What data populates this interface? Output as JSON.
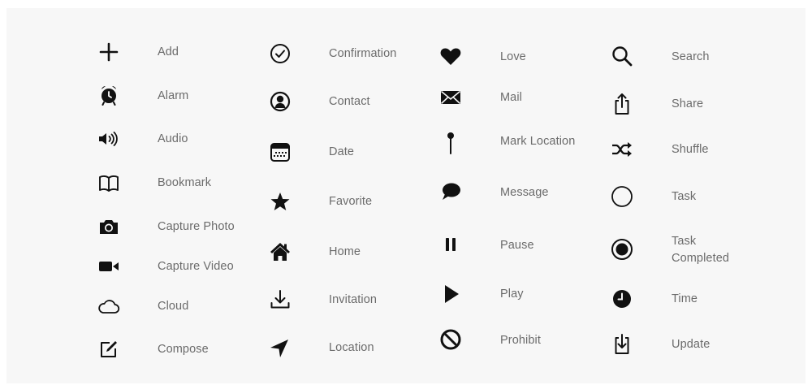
{
  "columns": [
    {
      "items": [
        {
          "icon": "plus-icon",
          "label": "Add"
        },
        {
          "icon": "alarm-icon",
          "label": "Alarm"
        },
        {
          "icon": "speaker-icon",
          "label": "Audio"
        },
        {
          "icon": "open-book-icon",
          "label": "Bookmark"
        },
        {
          "icon": "camera-icon",
          "label": "Capture Photo"
        },
        {
          "icon": "video-camera-icon",
          "label": "Capture Video"
        },
        {
          "icon": "cloud-icon",
          "label": "Cloud"
        },
        {
          "icon": "compose-icon",
          "label": "Compose"
        }
      ]
    },
    {
      "items": [
        {
          "icon": "check-circle-icon",
          "label": "Confirmation"
        },
        {
          "icon": "contact-icon",
          "label": "Contact"
        },
        {
          "icon": "calendar-icon",
          "label": "Date"
        },
        {
          "icon": "star-icon",
          "label": "Favorite"
        },
        {
          "icon": "home-icon",
          "label": "Home"
        },
        {
          "icon": "download-icon",
          "label": "Invitation"
        },
        {
          "icon": "location-arrow-icon",
          "label": "Location"
        }
      ]
    },
    {
      "items": [
        {
          "icon": "heart-icon",
          "label": "Love"
        },
        {
          "icon": "envelope-icon",
          "label": "Mail"
        },
        {
          "icon": "pin-icon",
          "label": "Mark Location"
        },
        {
          "icon": "speech-bubble-icon",
          "label": "Message"
        },
        {
          "icon": "pause-icon",
          "label": "Pause"
        },
        {
          "icon": "play-icon",
          "label": "Play"
        },
        {
          "icon": "prohibit-icon",
          "label": "Prohibit"
        }
      ]
    },
    {
      "items": [
        {
          "icon": "magnifier-icon",
          "label": "Search"
        },
        {
          "icon": "share-icon",
          "label": "Share"
        },
        {
          "icon": "shuffle-icon",
          "label": "Shuffle"
        },
        {
          "icon": "empty-circle-icon",
          "label": "Task"
        },
        {
          "icon": "radio-filled-icon",
          "label": "Task Completed"
        },
        {
          "icon": "clock-icon",
          "label": "Time"
        },
        {
          "icon": "update-icon",
          "label": "Update"
        }
      ]
    }
  ],
  "colors": {
    "icon": "#111111",
    "label": "#6b6b6b",
    "panel": "#f7f7f7",
    "page": "#ffffff"
  }
}
